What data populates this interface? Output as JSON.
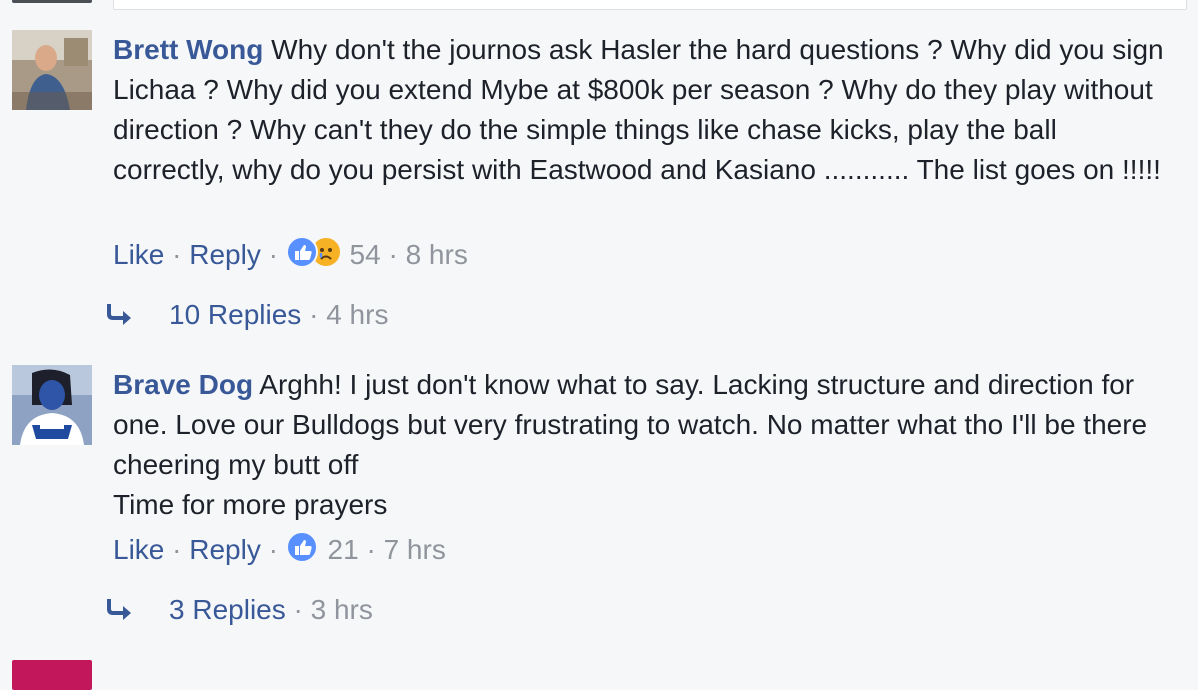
{
  "comments": [
    {
      "author": "Brett Wong",
      "text": "Why don't the journos ask Hasler the hard questions ? Why did you sign Lichaa ? Why did you extend Mybe at $800k per season ? Why do they play without direction ? Why can't they do the simple things like chase kicks, play the ball correctly, why do you persist with Eastwood and Kasiano ........... The list goes on !!!!!",
      "like_label": "Like",
      "reply_label": "Reply",
      "reactions": [
        "like",
        "sad"
      ],
      "reaction_count": "54",
      "time": "8 hrs",
      "replies_label": "10 Replies",
      "replies_time": "4 hrs"
    },
    {
      "author": "Brave Dog",
      "text": "Arghh! I just don't know what to say. Lacking structure and direction for one. Love our Bulldogs but very frustrating to watch. No matter what tho I'll be there cheering my butt off",
      "text_line2": "Time for more prayers",
      "like_label": "Like",
      "reply_label": "Reply",
      "reactions": [
        "like"
      ],
      "reaction_count": "21",
      "time": "7 hrs",
      "replies_label": "3 Replies",
      "replies_time": "3 hrs"
    }
  ],
  "separator": " · ",
  "colors": {
    "link": "#385898",
    "meta": "#90949c",
    "like": "#5890ff",
    "sad": "#f7b125",
    "background": "#f6f7f9"
  },
  "icons": {
    "like_reaction": "thumbs-up-icon",
    "sad_reaction": "sad-face-icon",
    "reply_arrow": "reply-arrow-icon"
  }
}
